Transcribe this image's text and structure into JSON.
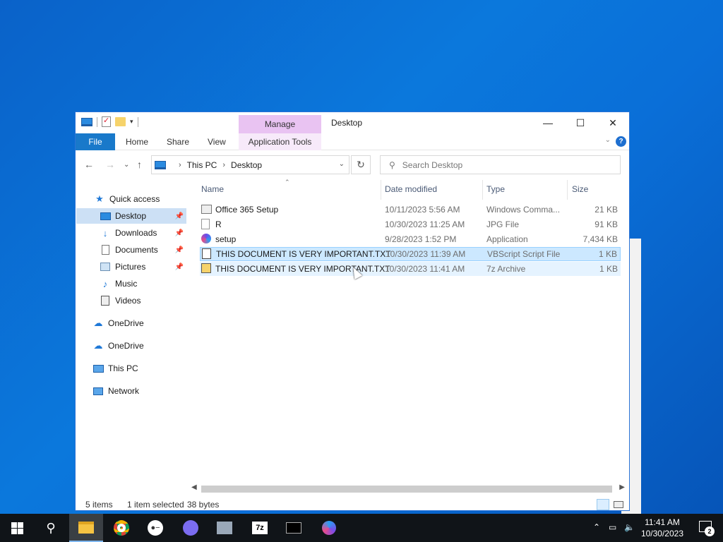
{
  "window": {
    "title": "Desktop",
    "manage_tab": "Manage",
    "ribbon": {
      "file": "File",
      "home": "Home",
      "share": "Share",
      "view": "View",
      "application_tools": "Application Tools"
    },
    "help": "?"
  },
  "address": {
    "crumbs": [
      "This PC",
      "Desktop"
    ]
  },
  "search": {
    "placeholder": "Search Desktop"
  },
  "sidebar": {
    "items": [
      {
        "label": "Quick access",
        "icon": "star-icon"
      },
      {
        "label": "Desktop",
        "icon": "desktop-icon",
        "pinned": true,
        "selected": true
      },
      {
        "label": "Downloads",
        "icon": "download-icon",
        "pinned": true
      },
      {
        "label": "Documents",
        "icon": "documents-icon",
        "pinned": true
      },
      {
        "label": "Pictures",
        "icon": "pictures-icon",
        "pinned": true
      },
      {
        "label": "Music",
        "icon": "music-icon"
      },
      {
        "label": "Videos",
        "icon": "videos-icon"
      },
      {
        "label": "OneDrive",
        "icon": "cloud-icon"
      },
      {
        "label": "OneDrive",
        "icon": "cloud-icon"
      },
      {
        "label": "This PC",
        "icon": "computer-icon"
      },
      {
        "label": "Network",
        "icon": "network-icon"
      }
    ]
  },
  "columns": {
    "name": "Name",
    "date": "Date modified",
    "type": "Type",
    "size": "Size"
  },
  "files": [
    {
      "name": "Office 365 Setup",
      "date": "10/11/2023 5:56 AM",
      "type": "Windows Comma...",
      "size": "21 KB",
      "icon": "cmd-file-icon"
    },
    {
      "name": "R",
      "date": "10/30/2023 11:25 AM",
      "type": "JPG File",
      "size": "91 KB",
      "icon": "image-file-icon"
    },
    {
      "name": "setup",
      "date": "9/28/2023 1:52 PM",
      "type": "Application",
      "size": "7,434 KB",
      "icon": "app-icon"
    },
    {
      "name": "THIS DOCUMENT IS VERY IMPORTANT.TXT",
      "date": "10/30/2023 11:39 AM",
      "type": "VBScript Script File",
      "size": "1 KB",
      "icon": "vbscript-file-icon",
      "selected": true
    },
    {
      "name": "THIS DOCUMENT IS VERY IMPORTANT.TXT",
      "date": "10/30/2023 11:41 AM",
      "type": "7z Archive",
      "size": "1 KB",
      "icon": "7z-archive-icon",
      "hovered": true
    }
  ],
  "status": {
    "items": "5 items",
    "selected": "1 item selected",
    "size": "38 bytes"
  },
  "taskbar": {
    "time": "11:41 AM",
    "date": "10/30/2023",
    "notification_count": "2",
    "apps": [
      "start-icon",
      "search-icon",
      "file-explorer-icon",
      "chrome-icon",
      "remote-icon",
      "discord-icon",
      "app-icon",
      "7zip-icon",
      "terminal-icon",
      "copilot-icon"
    ]
  },
  "colors": {
    "accent": "#1979ca",
    "selection": "#cce8ff",
    "manage": "#e9c3f2"
  }
}
